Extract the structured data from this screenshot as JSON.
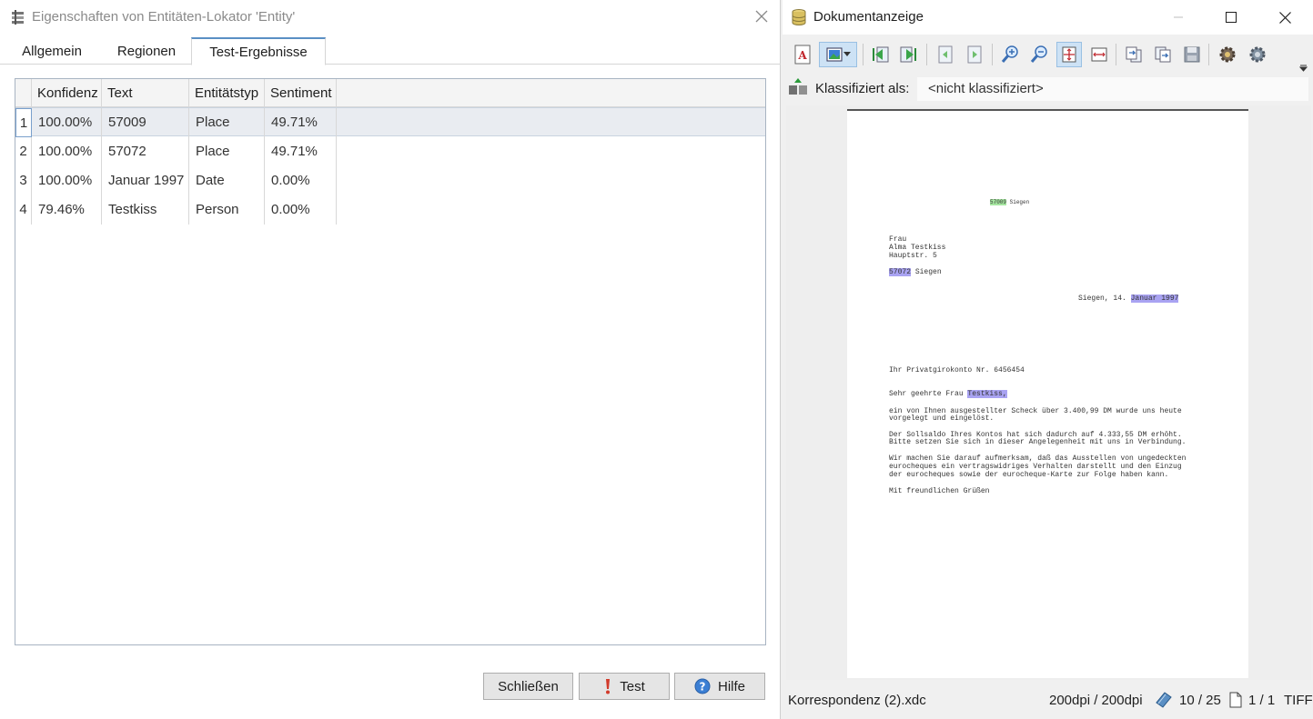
{
  "dialog": {
    "title": "Eigenschaften von Entitäten-Lokator 'Entity'",
    "tabs": [
      {
        "label": "Allgemein"
      },
      {
        "label": "Regionen"
      },
      {
        "label": "Test-Ergebnisse",
        "active": true
      }
    ],
    "grid": {
      "columns": [
        "Konfidenz",
        "Text",
        "Entitätstyp",
        "Sentiment"
      ],
      "rows": [
        {
          "num": "1",
          "konfidenz": "100.00%",
          "text": "57009",
          "typ": "Place",
          "sentiment": "49.71%",
          "selected": true
        },
        {
          "num": "2",
          "konfidenz": "100.00%",
          "text": "57072",
          "typ": "Place",
          "sentiment": "49.71%"
        },
        {
          "num": "3",
          "konfidenz": "100.00%",
          "text": "Januar 1997",
          "typ": "Date",
          "sentiment": "0.00%"
        },
        {
          "num": "4",
          "konfidenz": "79.46%",
          "text": "Testkiss",
          "typ": "Person",
          "sentiment": "0.00%"
        }
      ]
    },
    "buttons": {
      "close": "Schließen",
      "test": "Test",
      "help": "Hilfe"
    }
  },
  "viewer": {
    "title": "Dokumentanzeige",
    "classify_label": "Klassifiziert als:",
    "classify_value": "<nicht klassifiziert>",
    "document": {
      "sender_line_hl": "57009",
      "sender_line_rest": " Siegen",
      "addr1": "Frau",
      "addr2": "Alma Testkiss",
      "addr3": "Hauptstr. 5",
      "addr4_hl": "57072",
      "addr4_rest": " Siegen",
      "date_pre": "Siegen, 14. ",
      "date_hl": "Januar 1997",
      "subject": "Ihr Privatgirokonto Nr. 6456454",
      "salutation_pre": "Sehr geehrte Frau ",
      "salutation_hl": "Testkiss,",
      "p1a": "ein von Ihnen ausgestellter Scheck über 3.400,99 DM wurde uns heute",
      "p1b": "vorgelegt und eingelöst.",
      "p2a": "Der Sollsaldo Ihres Kontos hat sich dadurch auf 4.333,55 DM erhöht.",
      "p2b": "Bitte setzen Sie sich in dieser Angelegenheit mit uns in Verbindung.",
      "p3a": "Wir machen Sie darauf aufmerksam, daß das Ausstellen von ungedeckten",
      "p3b": "eurocheques ein vertragswidriges Verhalten darstellt und den Einzug",
      "p3c": "der eurocheques sowie der eurocheque-Karte zur Folge haben kann.",
      "closing": "Mit freundlichen Grüßen"
    },
    "status": {
      "filename": "Korrespondenz (2).xdc",
      "dpi": "200dpi / 200dpi",
      "doc_index": "10 / 25",
      "page_index": "1 / 1",
      "format": "TIFF"
    }
  },
  "colors": {
    "tab_accent": "#5a8fc4",
    "highlight_blue": "#a9a3f2",
    "highlight_green": "#a5e6a0",
    "selection": "#e9ecf1"
  }
}
